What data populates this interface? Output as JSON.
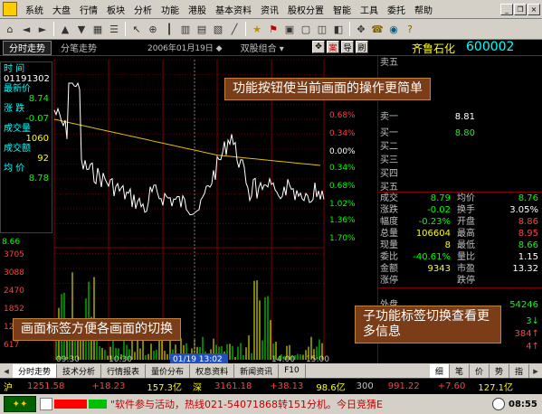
{
  "menu": [
    "系统",
    "大盘",
    "行情",
    "板块",
    "分析",
    "功能",
    "港股",
    "基本资料",
    "资讯",
    "股权分置",
    "智能",
    "工具",
    "委托",
    "帮助"
  ],
  "win_buttons": [
    "_",
    "❐",
    "×"
  ],
  "tabs": {
    "active": "分时走势",
    "inactive": "分笔走势"
  },
  "date": "2006年01月19日 ◆",
  "combo": "双股组合 ▾",
  "title_buttons": [
    "✥",
    "案",
    "导",
    "刷"
  ],
  "stock": {
    "name": "齐鲁石化",
    "code": "600002"
  },
  "info": [
    {
      "label": "时  间",
      "value": "01191302",
      "cls": "w"
    },
    {
      "label": "最新价",
      "value": "8.74",
      "cls": "g"
    },
    {
      "label": "涨  跌",
      "value": "-0.07",
      "cls": "g"
    },
    {
      "label": "成交量",
      "value": "1060",
      "cls": "y"
    },
    {
      "label": "成交额",
      "value": "92",
      "cls": "y"
    },
    {
      "label": "均  价",
      "value": "8.78",
      "cls": "g"
    }
  ],
  "pct_labels": [
    "0.68%",
    "0.34%",
    "0.00%",
    "0.34%",
    "0.68%",
    "1.02%",
    "1.36%",
    "1.70%"
  ],
  "price_left": "8.66",
  "vol_labels": [
    "3705",
    "3088",
    "2470",
    "1852",
    "1235",
    "617"
  ],
  "time_labels": [
    "09:30",
    "10:30",
    "13:00",
    "14:00",
    "15:00"
  ],
  "cursor_time": "01/19 13:02",
  "orderbook": [
    {
      "k": "卖五",
      "p": "",
      "cls": "w"
    },
    {
      "k": "卖一",
      "p": "8.81",
      "cls": "w"
    },
    {
      "k": "买一",
      "p": "8.80",
      "cls": "g"
    },
    {
      "k": "买二",
      "p": "",
      "cls": "w"
    },
    {
      "k": "买三",
      "p": "",
      "cls": "w"
    },
    {
      "k": "买四",
      "p": "",
      "cls": "w"
    },
    {
      "k": "买五",
      "p": "",
      "cls": "w"
    }
  ],
  "stats": [
    {
      "k1": "成交",
      "v1": "8.79",
      "c1": "g",
      "k2": "均价",
      "v2": "8.76",
      "c2": "g"
    },
    {
      "k1": "涨跌",
      "v1": "-0.02",
      "c1": "g",
      "k2": "换手",
      "v2": "3.05%",
      "c2": "w"
    },
    {
      "k1": "幅度",
      "v1": "-0.23%",
      "c1": "g",
      "k2": "开盘",
      "v2": "8.86",
      "c2": "r"
    },
    {
      "k1": "总量",
      "v1": "106604",
      "c1": "y",
      "k2": "最高",
      "v2": "8.95",
      "c2": "r"
    },
    {
      "k1": "现量",
      "v1": "8",
      "c1": "y",
      "k2": "最低",
      "v2": "8.66",
      "c2": "g"
    },
    {
      "k1": "委比",
      "v1": "-40.61%",
      "c1": "g",
      "k2": "量比",
      "v2": "1.15",
      "c2": "w"
    },
    {
      "k1": "金额",
      "v1": "9343",
      "c1": "y",
      "k2": "市盈",
      "v2": "13.32",
      "c2": "w"
    },
    {
      "k1": "涨停",
      "v1": "",
      "c1": "r",
      "k2": "跌停",
      "v2": "",
      "c2": "g"
    }
  ],
  "outer_label": "外盘",
  "outer_val": "54246",
  "tick_side": [
    "3↓",
    "384↑",
    "4↑"
  ],
  "callouts": {
    "top": "功能按钮使当前画面的操作更简单",
    "left": "画面标签方便各画面的切换",
    "right": "子功能标签切换查看更多信息"
  },
  "bottom_tabs": [
    "分时走势",
    "技术分析",
    "行情报表",
    "量价分布",
    "权息资料",
    "新闻资讯",
    "F10"
  ],
  "sub_tabs": [
    "细",
    "笔",
    "价",
    "势",
    "指"
  ],
  "index": {
    "sh": {
      "name": "沪",
      "price": "1251.58",
      "chg": "+18.23",
      "amt": "157.3亿"
    },
    "sz": {
      "name": "深",
      "price": "3161.18",
      "chg": "+38.13",
      "amt": "98.6亿"
    },
    "other": {
      "price": "300",
      "val": "991.22",
      "chg": "+7.60",
      "amt": "127.1亿"
    }
  },
  "status": {
    "ticker": "\"软件参与活动，热线021-54071868转151分机。今日竞猜E",
    "time": "08:55"
  },
  "colors": {
    "up": "#ff4040",
    "down": "#00ff00",
    "price_line": "#ffffff",
    "avg_line": "#ffff00",
    "callout_bg": "#7a3d18"
  }
}
